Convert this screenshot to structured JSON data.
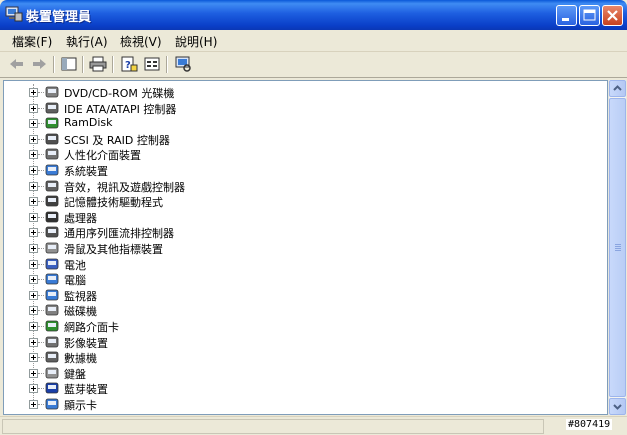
{
  "window": {
    "title": "裝置管理員",
    "minimize_icon": "minimize-icon",
    "maximize_icon": "maximize-icon",
    "close_icon": "close-icon"
  },
  "menu": {
    "items": [
      "檔案(F)",
      "執行(A)",
      "檢視(V)",
      "說明(H)"
    ]
  },
  "toolbar": {
    "icons": [
      "back-arrow-icon",
      "forward-arrow-icon",
      "show-hide-tree-icon",
      "print-icon",
      "help-icon",
      "properties-icon",
      "scan-hardware-icon"
    ]
  },
  "tree": {
    "items": [
      {
        "label": "DVD/CD-ROM 光碟機",
        "icon": "cdrom-icon",
        "color": "#808080"
      },
      {
        "label": "IDE ATA/ATAPI 控制器",
        "icon": "ide-controller-icon",
        "color": "#606060"
      },
      {
        "label": "RamDisk",
        "icon": "ramdisk-icon",
        "color": "#2f8f2f"
      },
      {
        "label": "SCSI 及 RAID 控制器",
        "icon": "scsi-icon",
        "color": "#505050"
      },
      {
        "label": "人性化介面裝置",
        "icon": "hid-icon",
        "color": "#707070"
      },
      {
        "label": "系統裝置",
        "icon": "system-device-icon",
        "color": "#3a7bd5"
      },
      {
        "label": "音效，視訊及遊戲控制器",
        "icon": "sound-icon",
        "color": "#606060"
      },
      {
        "label": "記憶體技術驅動程式",
        "icon": "memory-tech-icon",
        "color": "#404040"
      },
      {
        "label": "處理器",
        "icon": "processor-icon",
        "color": "#303030"
      },
      {
        "label": "通用序列匯流排控制器",
        "icon": "usb-icon",
        "color": "#505050"
      },
      {
        "label": "滑鼠及其他指標裝置",
        "icon": "mouse-icon",
        "color": "#909090"
      },
      {
        "label": "電池",
        "icon": "battery-icon",
        "color": "#3a5fc0"
      },
      {
        "label": "電腦",
        "icon": "computer-icon",
        "color": "#3a7bd5"
      },
      {
        "label": "監視器",
        "icon": "monitor-icon",
        "color": "#3a7bd5"
      },
      {
        "label": "磁碟機",
        "icon": "disk-drive-icon",
        "color": "#808080"
      },
      {
        "label": "網路介面卡",
        "icon": "network-adapter-icon",
        "color": "#2f8f2f"
      },
      {
        "label": "影像裝置",
        "icon": "imaging-icon",
        "color": "#707070"
      },
      {
        "label": "數據機",
        "icon": "modem-icon",
        "color": "#606060"
      },
      {
        "label": "鍵盤",
        "icon": "keyboard-icon",
        "color": "#909090"
      },
      {
        "label": "藍芽裝置",
        "icon": "bluetooth-icon",
        "color": "#1a3fa8"
      },
      {
        "label": "顯示卡",
        "icon": "display-adapter-icon",
        "color": "#3a7bd5"
      }
    ]
  },
  "watermark": "#807419"
}
